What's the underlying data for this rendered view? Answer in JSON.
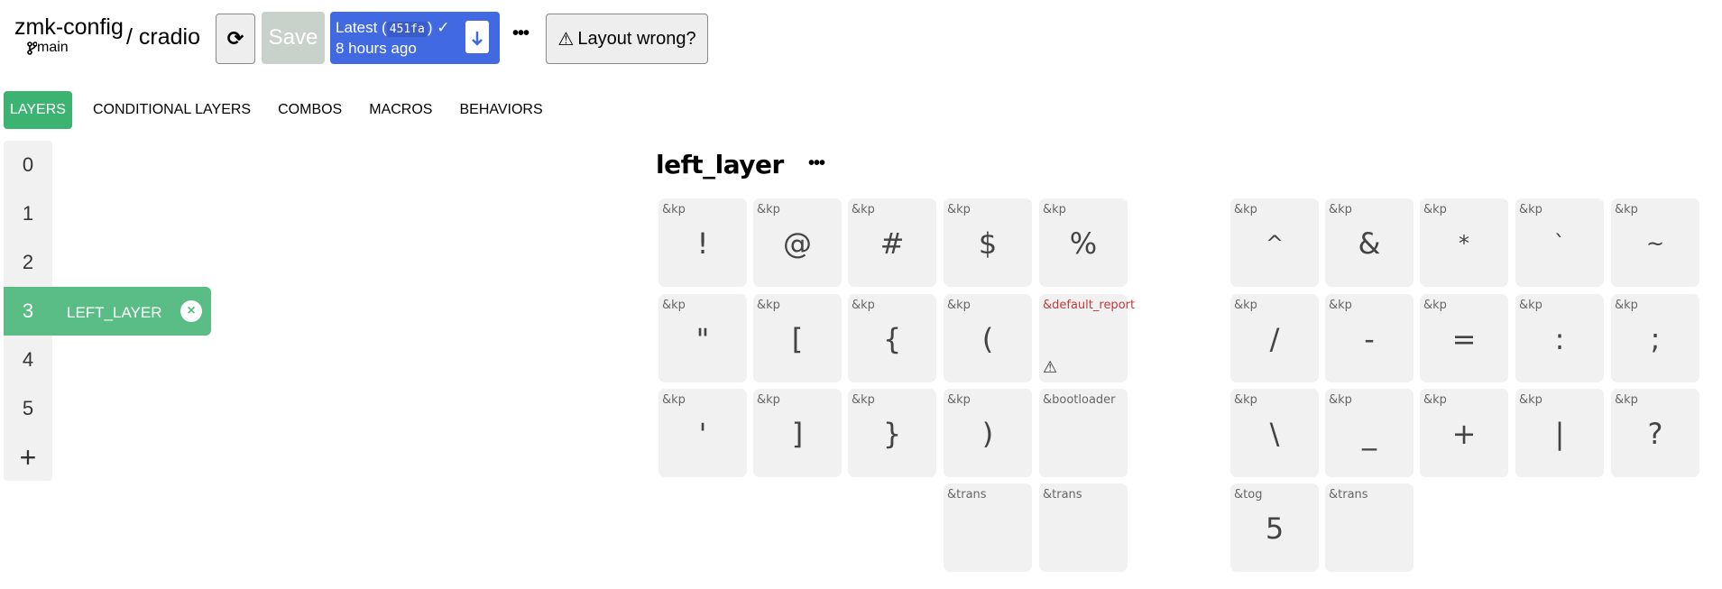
{
  "header": {
    "repo": "zmk-config",
    "branch": "main",
    "keyboard": "/ cradio",
    "save_label": "Save",
    "latest_label": "Latest (",
    "latest_hash": "451fa",
    "latest_close": ")",
    "latest_time": "8 hours ago",
    "more_label": "•••",
    "layout_wrong_label": "Layout wrong?"
  },
  "tabs": [
    {
      "label": "LAYERS",
      "active": true
    },
    {
      "label": "CONDITIONAL LAYERS"
    },
    {
      "label": "COMBOS"
    },
    {
      "label": "MACROS"
    },
    {
      "label": "BEHAVIORS"
    }
  ],
  "layers": [
    {
      "index": "0"
    },
    {
      "index": "1"
    },
    {
      "index": "2"
    },
    {
      "index": "3",
      "name": "LEFT_LAYER",
      "active": true
    },
    {
      "index": "4"
    },
    {
      "index": "5"
    }
  ],
  "add_layer": "+",
  "layer_title": "left_layer",
  "layer_menu": "•••",
  "colors": {
    "accent": "#3cb371",
    "active_layer": "#59bd85",
    "latest": "#4169e1",
    "error": "#c0393b",
    "key_bg": "#f1f1f1"
  },
  "keys": [
    {
      "b": "&kp",
      "p": "!"
    },
    {
      "b": "&kp",
      "p": "@"
    },
    {
      "b": "&kp",
      "p": "#"
    },
    {
      "b": "&kp",
      "p": "$"
    },
    {
      "b": "&kp",
      "p": "%"
    },
    {
      "b": "&kp",
      "p": "^"
    },
    {
      "b": "&kp",
      "p": "&"
    },
    {
      "b": "&kp",
      "p": "*"
    },
    {
      "b": "&kp",
      "p": "`"
    },
    {
      "b": "&kp",
      "p": "~"
    },
    {
      "b": "&kp",
      "p": "\""
    },
    {
      "b": "&kp",
      "p": "["
    },
    {
      "b": "&kp",
      "p": "{"
    },
    {
      "b": "&kp",
      "p": "("
    },
    {
      "b": "&default_report",
      "p": "",
      "error": true
    },
    {
      "b": "&kp",
      "p": "/"
    },
    {
      "b": "&kp",
      "p": "-"
    },
    {
      "b": "&kp",
      "p": "="
    },
    {
      "b": "&kp",
      "p": ":"
    },
    {
      "b": "&kp",
      "p": ";"
    },
    {
      "b": "&kp",
      "p": "'"
    },
    {
      "b": "&kp",
      "p": "]"
    },
    {
      "b": "&kp",
      "p": "}"
    },
    {
      "b": "&kp",
      "p": ")"
    },
    {
      "b": "&bootloader",
      "p": ""
    },
    {
      "b": "&kp",
      "p": "\\"
    },
    {
      "b": "&kp",
      "p": "_"
    },
    {
      "b": "&kp",
      "p": "+"
    },
    {
      "b": "&kp",
      "p": "|"
    },
    {
      "b": "&kp",
      "p": "?"
    },
    {
      "b": "&trans",
      "p": ""
    },
    {
      "b": "&trans",
      "p": ""
    },
    {
      "b": "&tog",
      "p": "5"
    },
    {
      "b": "&trans",
      "p": ""
    }
  ]
}
